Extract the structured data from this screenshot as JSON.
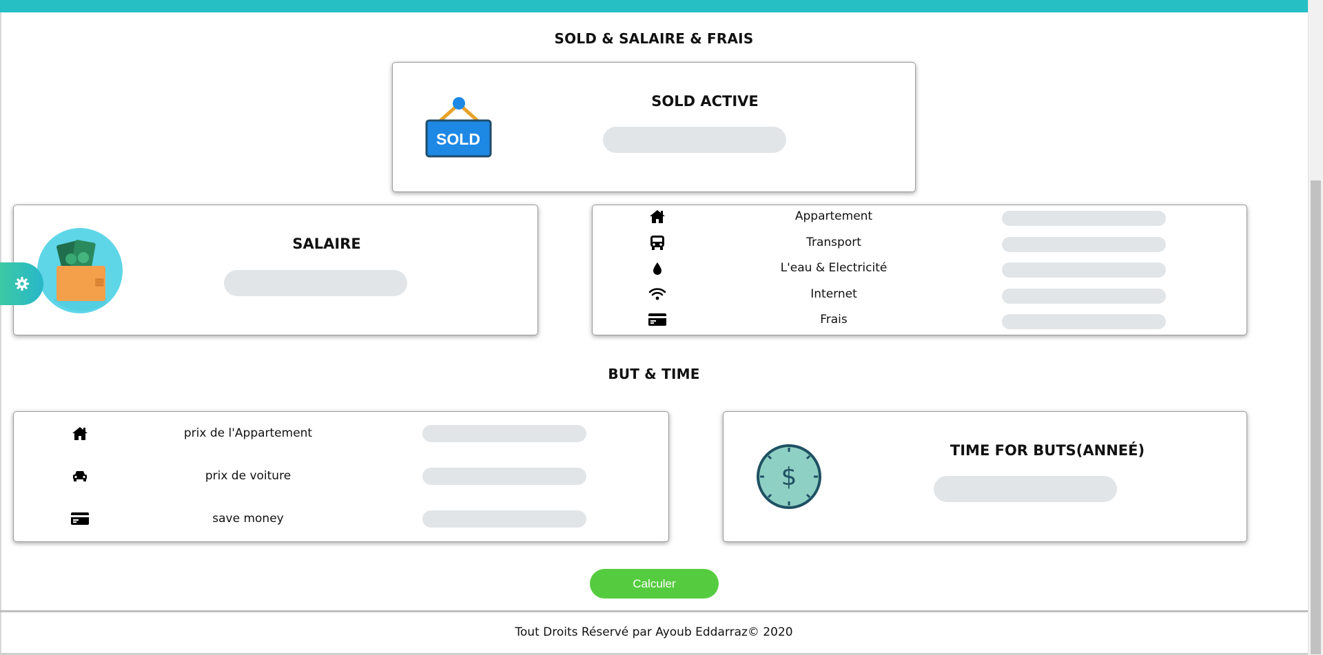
{
  "header": {
    "section1_title": "SOLD & SALAIRE & FRAIS",
    "section2_title": "BUT & TIME"
  },
  "sold_card": {
    "title": "SOLD ACTIVE",
    "sign_text": "SOLD",
    "value": ""
  },
  "salaire_card": {
    "title": "SALAIRE",
    "value": ""
  },
  "frais_card": {
    "rows": [
      {
        "icon": "home-icon",
        "label": "Appartement",
        "value": ""
      },
      {
        "icon": "bus-icon",
        "label": "Transport",
        "value": ""
      },
      {
        "icon": "water-drop-icon",
        "label": "L'eau & Electricité",
        "value": ""
      },
      {
        "icon": "wifi-icon",
        "label": "Internet",
        "value": ""
      },
      {
        "icon": "credit-card-icon",
        "label": "Frais",
        "value": ""
      }
    ]
  },
  "but_card": {
    "rows": [
      {
        "icon": "home-icon",
        "label": "prix de l'Appartement",
        "value": ""
      },
      {
        "icon": "car-icon",
        "label": "prix de voiture",
        "value": ""
      },
      {
        "icon": "credit-card-icon",
        "label": "save money",
        "value": ""
      }
    ]
  },
  "time_card": {
    "title": "TIME FOR BUTS(ANNEÉ)",
    "symbol": "$",
    "value": ""
  },
  "actions": {
    "calculate_label": "Calculer"
  },
  "footer": {
    "text": "Tout Droits Réservé par Ayoub Eddarraz© 2020"
  },
  "colors": {
    "accent": "#26bfc4",
    "button": "#55cc3f",
    "pill": "#e2e5e8",
    "settings_tab": "#3cc9a3"
  }
}
